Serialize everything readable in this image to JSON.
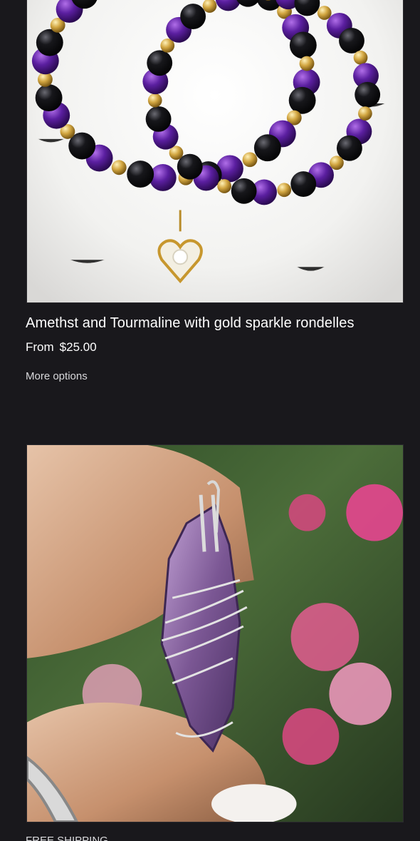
{
  "products": [
    {
      "title": "Amethst and Tourmaline with gold sparkle rondelles",
      "price_prefix": "From",
      "price": "$25.00",
      "more_options_label": "More options"
    },
    {
      "badge": "FREE SHIPPING"
    }
  ],
  "colors": {
    "background": "#19181c",
    "text": "#ffffff",
    "secondary_text": "#d9d9dc"
  }
}
